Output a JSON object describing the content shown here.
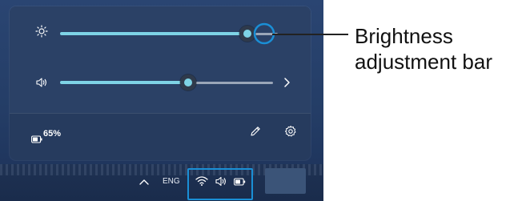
{
  "quick_settings": {
    "brightness": {
      "level": 0.86,
      "icon": "sun-icon"
    },
    "volume": {
      "level": 0.6,
      "icon": "speaker-icon",
      "expand_icon": "chevron-right-icon"
    },
    "battery": {
      "percent_label": "65%",
      "icon": "battery-icon"
    },
    "footer_icons": [
      "pencil-icon",
      "gear-icon"
    ]
  },
  "taskbar": {
    "language": "ENG",
    "icons": [
      "chevron-up-icon",
      "wifi-icon",
      "speaker-icon",
      "battery-icon"
    ]
  },
  "callout": {
    "line1": "Brightness",
    "line2": "adjustment bar"
  },
  "colors": {
    "accent": "#7ed3e6",
    "highlight": "#1a8fd6",
    "panel": "#2b4166"
  }
}
